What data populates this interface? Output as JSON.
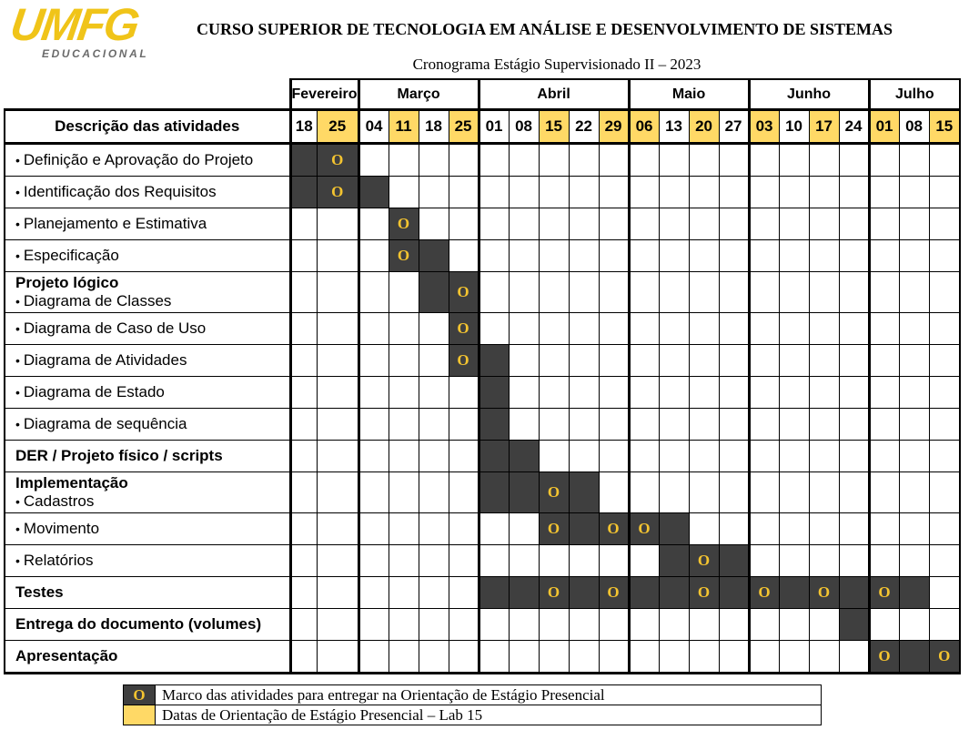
{
  "header": {
    "logo_main": "UMFG",
    "logo_sub": "EDUCACIONAL",
    "title": "CURSO SUPERIOR DE TECNOLOGIA EM ANÁLISE E DESENVOLVIMENTO DE SISTEMAS",
    "subtitle": "Cronograma Estágio Supervisionado II – 2023"
  },
  "colors": {
    "dark": "#3f3f3f",
    "yellow": "#ffd966",
    "marker": "#f4c430"
  },
  "marker_symbol": "O",
  "table": {
    "desc_header": "Descrição das atividades",
    "months": [
      {
        "label": "Fevereiro",
        "span": 2
      },
      {
        "label": "Março",
        "span": 4
      },
      {
        "label": "Abril",
        "span": 5
      },
      {
        "label": "Maio",
        "span": 4
      },
      {
        "label": "Junho",
        "span": 4
      },
      {
        "label": "Julho",
        "span": 3
      }
    ],
    "days": [
      {
        "d": "18",
        "y": false
      },
      {
        "d": "25",
        "y": true
      },
      {
        "d": "04",
        "y": false
      },
      {
        "d": "11",
        "y": true
      },
      {
        "d": "18",
        "y": false
      },
      {
        "d": "25",
        "y": true
      },
      {
        "d": "01",
        "y": false
      },
      {
        "d": "08",
        "y": false
      },
      {
        "d": "15",
        "y": true
      },
      {
        "d": "22",
        "y": false
      },
      {
        "d": "29",
        "y": true
      },
      {
        "d": "06",
        "y": true
      },
      {
        "d": "13",
        "y": false
      },
      {
        "d": "20",
        "y": true
      },
      {
        "d": "27",
        "y": false
      },
      {
        "d": "03",
        "y": true
      },
      {
        "d": "10",
        "y": false
      },
      {
        "d": "17",
        "y": true
      },
      {
        "d": "24",
        "y": false
      },
      {
        "d": "01",
        "y": true
      },
      {
        "d": "08",
        "y": false
      },
      {
        "d": "15",
        "y": true
      }
    ],
    "rows": [
      {
        "lines": [
          {
            "text": "Definição e Aprovação do Projeto",
            "bullet": true,
            "bold": false
          }
        ],
        "dark": [
          0,
          1
        ],
        "markers": [
          1
        ]
      },
      {
        "lines": [
          {
            "text": "Identificação dos Requisitos",
            "bullet": true,
            "bold": false
          }
        ],
        "dark": [
          0,
          1,
          2
        ],
        "markers": [
          1
        ]
      },
      {
        "lines": [
          {
            "text": "Planejamento e Estimativa",
            "bullet": true,
            "bold": false
          }
        ],
        "dark": [
          3
        ],
        "markers": [
          3
        ]
      },
      {
        "lines": [
          {
            "text": "Especificação",
            "bullet": true,
            "bold": false
          }
        ],
        "dark": [
          3,
          4
        ],
        "markers": [
          3
        ]
      },
      {
        "lines": [
          {
            "text": "Projeto lógico",
            "bullet": false,
            "bold": true
          },
          {
            "text": "Diagrama de Classes",
            "bullet": true,
            "bold": false
          }
        ],
        "dark": [
          4,
          5
        ],
        "markers": [
          5
        ]
      },
      {
        "lines": [
          {
            "text": "Diagrama de Caso de Uso",
            "bullet": true,
            "bold": false
          }
        ],
        "dark": [
          5
        ],
        "markers": [
          5
        ]
      },
      {
        "lines": [
          {
            "text": "Diagrama de Atividades",
            "bullet": true,
            "bold": false
          }
        ],
        "dark": [
          5,
          6
        ],
        "markers": [
          5
        ]
      },
      {
        "lines": [
          {
            "text": "Diagrama de Estado",
            "bullet": true,
            "bold": false
          }
        ],
        "dark": [
          6
        ],
        "markers": []
      },
      {
        "lines": [
          {
            "text": "Diagrama de sequência",
            "bullet": true,
            "bold": false
          }
        ],
        "dark": [
          6
        ],
        "markers": []
      },
      {
        "lines": [
          {
            "text": "DER / Projeto físico / scripts",
            "bullet": false,
            "bold": true
          }
        ],
        "dark": [
          6,
          7
        ],
        "markers": []
      },
      {
        "lines": [
          {
            "text": "Implementação",
            "bullet": false,
            "bold": true
          },
          {
            "text": "Cadastros",
            "bullet": true,
            "bold": false
          }
        ],
        "dark": [
          6,
          7,
          8,
          9
        ],
        "markers": [
          8
        ]
      },
      {
        "lines": [
          {
            "text": "Movimento",
            "bullet": true,
            "bold": false
          }
        ],
        "dark": [
          8,
          9,
          10,
          11,
          12
        ],
        "markers": [
          8,
          10,
          11
        ]
      },
      {
        "lines": [
          {
            "text": "Relatórios",
            "bullet": true,
            "bold": false
          }
        ],
        "dark": [
          12,
          13,
          14
        ],
        "markers": [
          13
        ]
      },
      {
        "lines": [
          {
            "text": "Testes",
            "bullet": false,
            "bold": true
          }
        ],
        "dark": [
          6,
          7,
          8,
          9,
          10,
          11,
          12,
          13,
          14,
          15,
          16,
          17,
          18,
          19,
          20
        ],
        "markers": [
          8,
          10,
          13,
          15,
          17,
          19
        ]
      },
      {
        "lines": [
          {
            "text": "Entrega do documento (volumes)",
            "bullet": false,
            "bold": true
          }
        ],
        "dark": [
          18
        ],
        "markers": []
      },
      {
        "lines": [
          {
            "text": "Apresentação",
            "bullet": false,
            "bold": true
          }
        ],
        "dark": [
          19,
          20,
          21
        ],
        "markers": [
          19,
          21
        ]
      }
    ]
  },
  "legend": [
    {
      "type": "marker",
      "text": "Marco das atividades para entregar na Orientação de Estágio Presencial"
    },
    {
      "type": "yellow",
      "text": "Datas de Orientação de Estágio Presencial – Lab 15"
    }
  ]
}
